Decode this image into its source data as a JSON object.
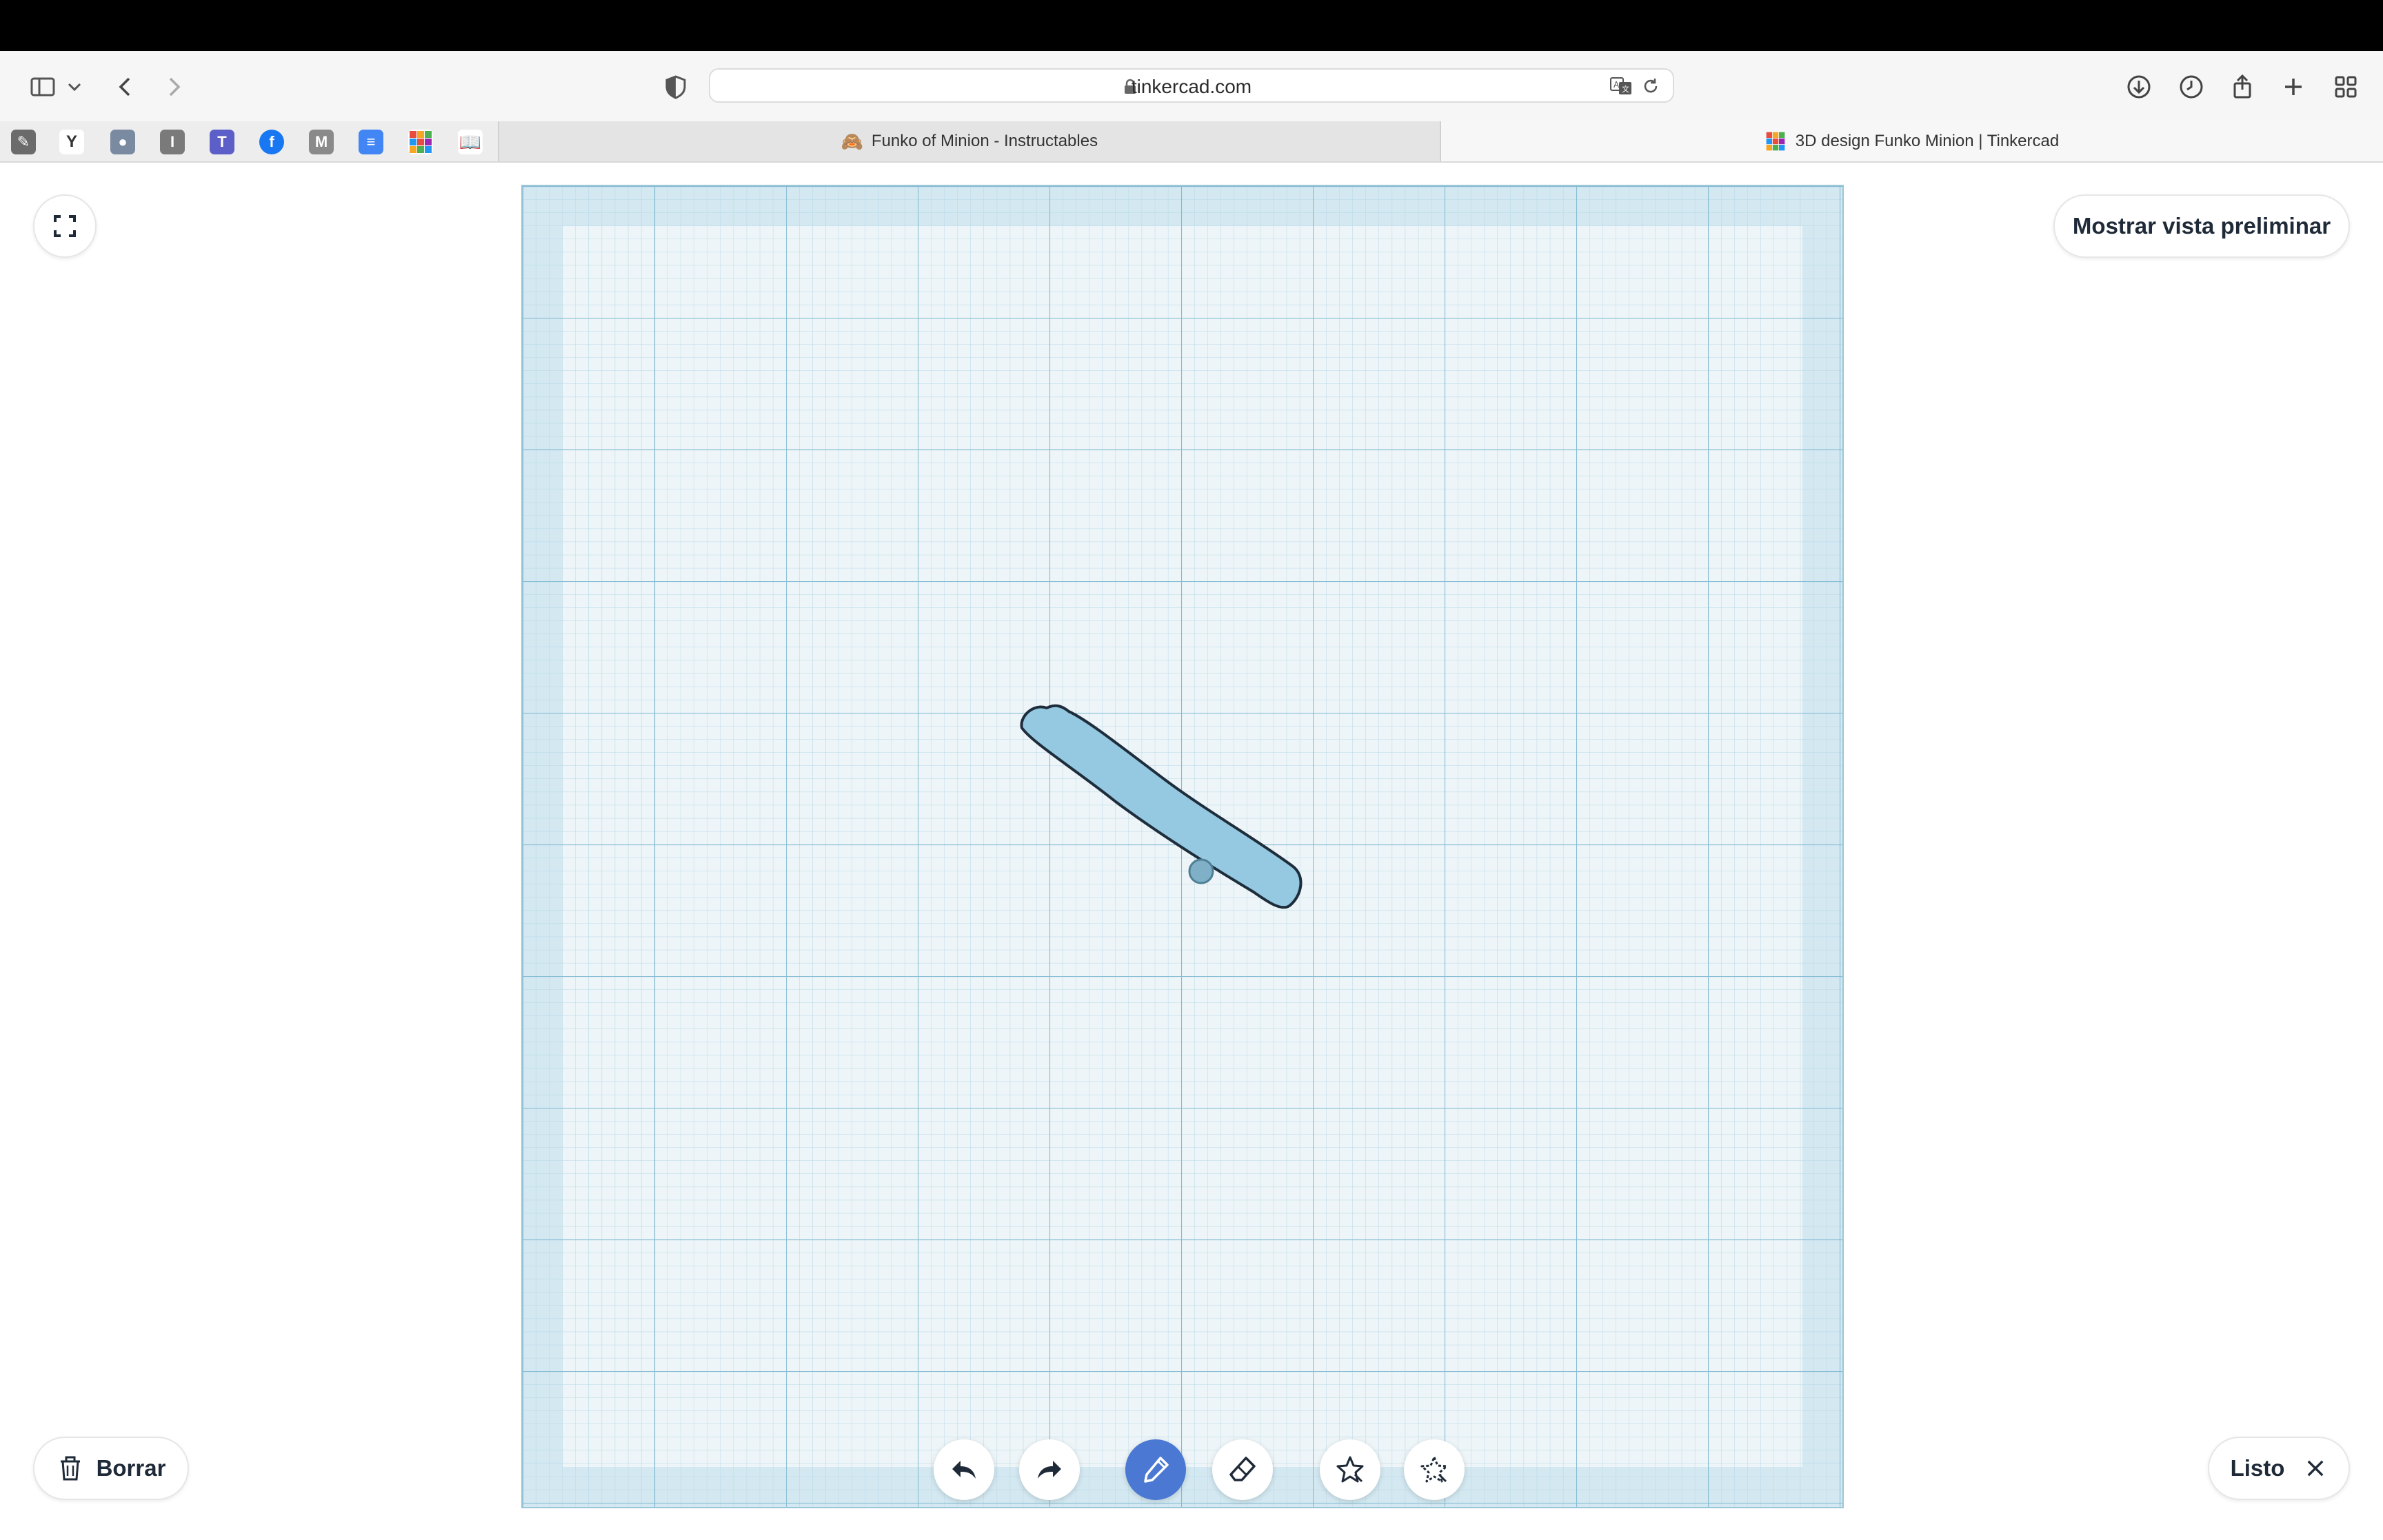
{
  "browser": {
    "url": "tinkercad.com",
    "tabs": [
      {
        "label": "Funko of Minion - Instructables",
        "active": false
      },
      {
        "label": "3D design Funko Minion | Tinkercad",
        "active": true
      }
    ],
    "bookmark_icons": [
      "notes-icon",
      "yale-icon",
      "seal-icon",
      "i-icon",
      "teams-icon",
      "facebook-icon",
      "m-icon",
      "docs-icon",
      "tinkercad-icon",
      "book-icon"
    ]
  },
  "editor": {
    "preview_label": "Mostrar vista preliminar",
    "delete_label": "Borrar",
    "done_label": "Listo",
    "tools": [
      "undo-icon",
      "redo-icon",
      "pencil-icon",
      "eraser-icon",
      "shape-add-icon",
      "shape-subtract-icon"
    ],
    "active_tool": "pencil-icon",
    "shape_color": "#95c9e1",
    "accent_color": "#4a78d3"
  }
}
